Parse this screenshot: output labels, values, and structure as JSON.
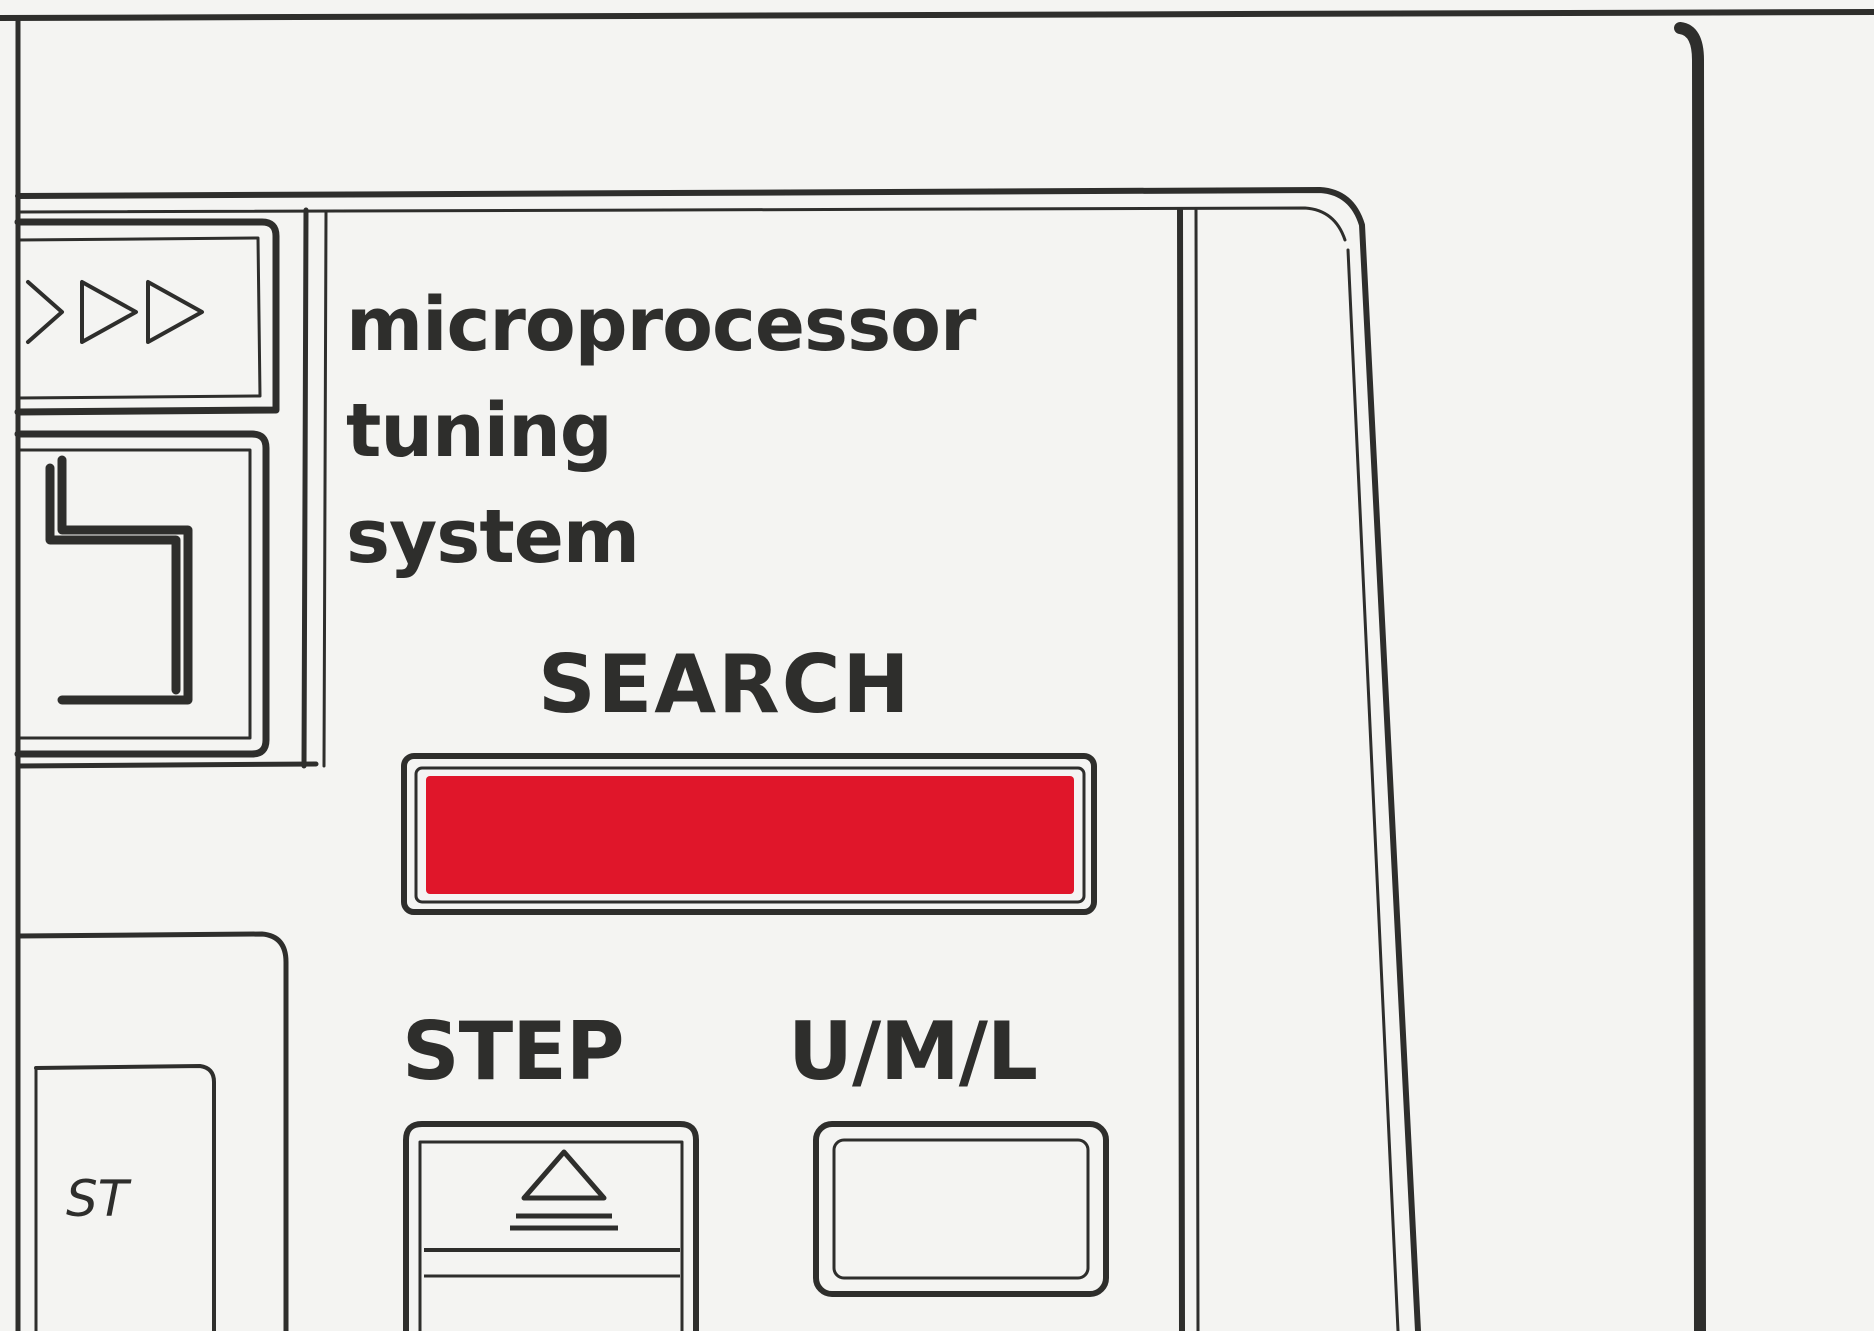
{
  "panel": {
    "brand_line1": "microprocessor",
    "brand_line2": "tuning",
    "brand_line3": "system",
    "search_label": "SEARCH",
    "step_label": "STEP",
    "uml_label": "U/M/L",
    "st_indicator": "ST",
    "search_indicator_color": "#e0162a",
    "step_button_icon": "triangle-up-icon",
    "transport_icon": "fast-forward-icon"
  }
}
